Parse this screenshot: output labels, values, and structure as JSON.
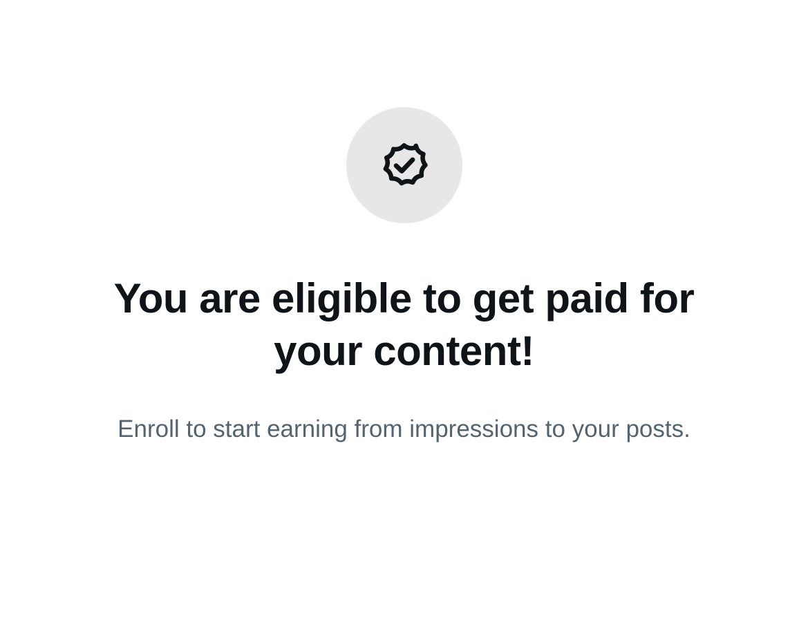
{
  "icon": {
    "name": "verified-badge-icon",
    "circle_color": "#e7e7e7",
    "stroke_color": "#0f1419"
  },
  "headline": {
    "line1": "You are eligible to get paid for",
    "line2": "your content!"
  },
  "subtitle": "Enroll to start earning from impressions to your posts."
}
